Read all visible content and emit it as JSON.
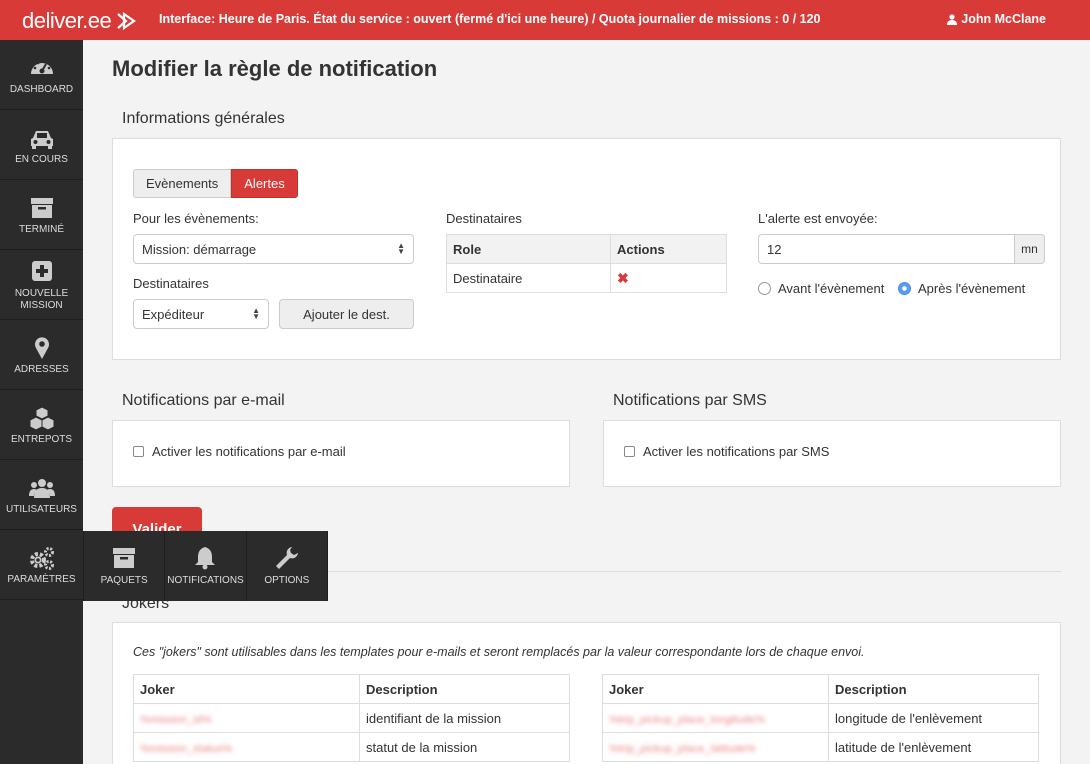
{
  "header": {
    "logo": "deliver.ee",
    "info": "Interface: Heure de Paris. État du service : ouvert (fermé d'ici une heure) / Quota journalier de missions : 0 / 120",
    "user": "John McClane"
  },
  "sidebar": {
    "items": [
      {
        "label": "DASHBOARD",
        "icon": "dashboard-icon"
      },
      {
        "label": "EN COURS",
        "icon": "car-icon"
      },
      {
        "label": "TERMINÉ",
        "icon": "archive-icon"
      },
      {
        "label": "NOUVELLE MISSION",
        "icon": "plus-icon"
      },
      {
        "label": "ADRESSES",
        "icon": "map-marker-icon"
      },
      {
        "label": "ENTREPOTS",
        "icon": "cubes-icon"
      },
      {
        "label": "UTILISATEURS",
        "icon": "users-icon"
      },
      {
        "label": "PARAMÈTRES",
        "icon": "cogs-icon"
      }
    ]
  },
  "submenu": {
    "items": [
      {
        "label": "PAQUETS",
        "icon": "archive-icon"
      },
      {
        "label": "NOTIFICATIONS",
        "icon": "bell-icon"
      },
      {
        "label": "OPTIONS",
        "icon": "wrench-icon"
      }
    ]
  },
  "page": {
    "title": "Modifier la règle de notification",
    "general_title": "Informations générales",
    "tabs": [
      "Evènements",
      "Alertes"
    ],
    "events_label": "Pour les évènements:",
    "events_value": "Mission: démarrage",
    "recipients_label": "Destinataires",
    "recipients_value": "Expéditeur",
    "add_recipient": "Ajouter le dest.",
    "dest_table": {
      "title": "Destinataires",
      "headers": [
        "Role",
        "Actions"
      ],
      "rows": [
        {
          "role": "Destinataire",
          "action": "✖"
        }
      ]
    },
    "alert_label": "L'alerte est envoyée:",
    "alert_value": "12",
    "alert_unit": "mn",
    "radio_before": "Avant l'évènement",
    "radio_after": "Après l'évènement",
    "email_title": "Notifications par e-mail",
    "email_check": "Activer les notifications par e-mail",
    "sms_title": "Notifications par SMS",
    "sms_check": "Activer les notifications par SMS",
    "validate": "Valider",
    "jokers_title": "Jokers",
    "jokers_desc": "Ces \"jokers\" sont utilisables dans les templates pour e-mails et seront remplacés par la valeur correspondante lors de chaque envoi.",
    "jokers_headers": [
      "Joker",
      "Description"
    ],
    "jokers_left": [
      {
        "joker": "%mission_id%",
        "desc": "identifiant de la mission"
      },
      {
        "joker": "%mission_status%",
        "desc": "statut de la mission"
      }
    ],
    "jokers_right": [
      {
        "joker": "%trip_pickup_place_longitude%",
        "desc": "longitude de l'enlèvement"
      },
      {
        "joker": "%trip_pickup_place_latitude%",
        "desc": "latitude de l'enlèvement"
      }
    ]
  }
}
